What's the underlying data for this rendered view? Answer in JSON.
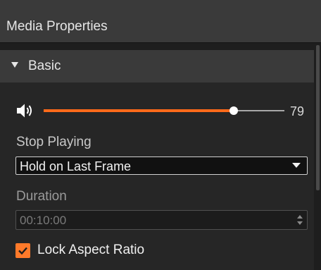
{
  "panel": {
    "title": "Media Properties"
  },
  "section": {
    "label": "Basic"
  },
  "volume": {
    "value_label": "79",
    "level": 0.79,
    "fill_color": "#ff6a1a",
    "icon": "speaker-icon"
  },
  "stop_playing": {
    "label": "Stop Playing",
    "selected": "Hold on Last Frame"
  },
  "duration": {
    "label": "Duration",
    "value": "00:10:00"
  },
  "lock_aspect": {
    "label": "Lock Aspect Ratio",
    "checked": true,
    "color": "#ff7a2a"
  }
}
